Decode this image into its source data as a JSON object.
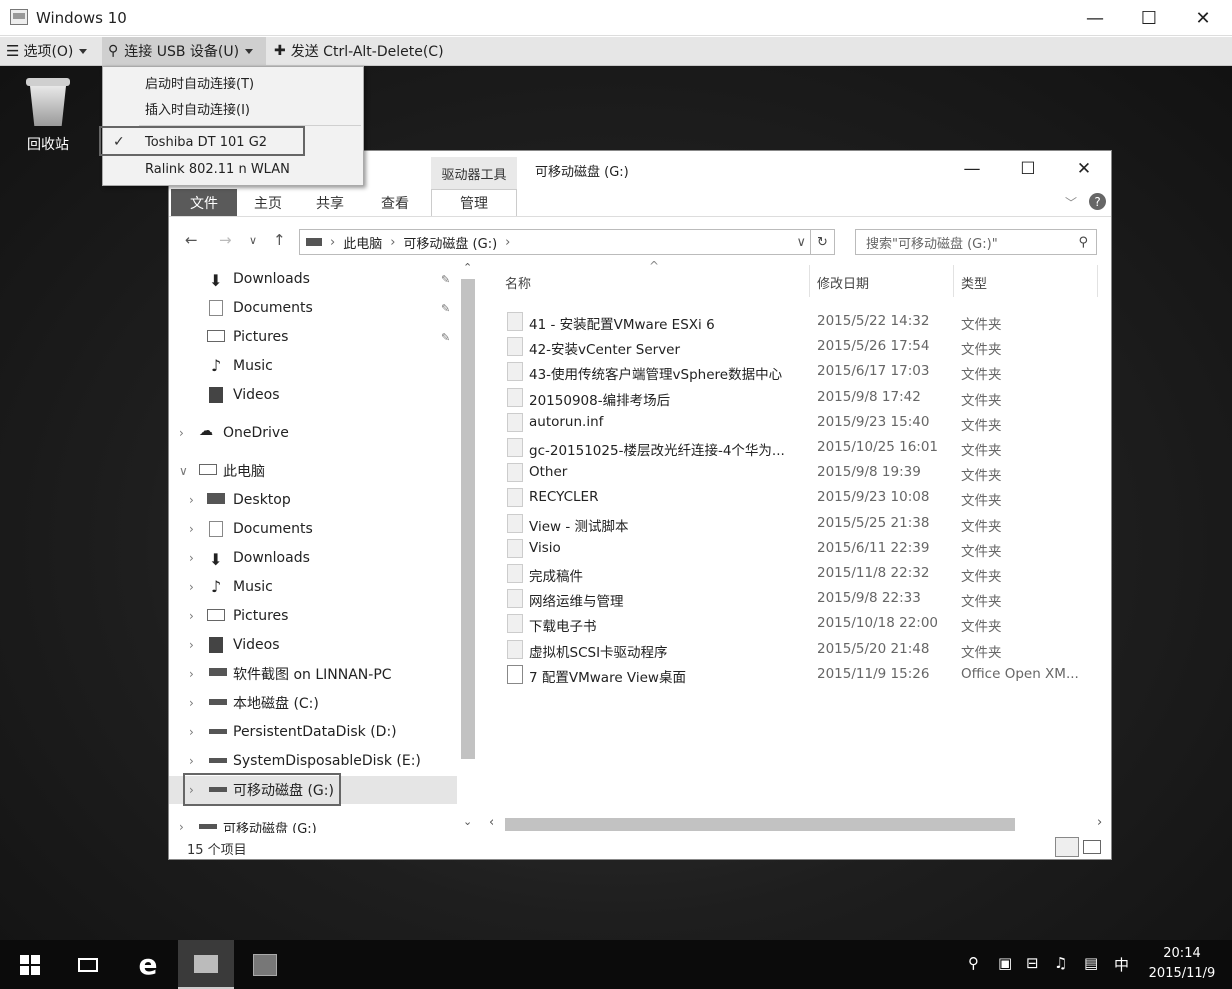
{
  "vm": {
    "title": "Windows 10",
    "menu": {
      "options": "选项(O)",
      "connect_usb": "连接 USB 设备(U)",
      "send_cad": "发送 Ctrl-Alt-Delete(C)"
    }
  },
  "dropdown": {
    "items": [
      {
        "label": "启动时自动连接(T)"
      },
      {
        "label": "插入时自动连接(I)"
      },
      {
        "label": "Toshiba DT 101 G2",
        "checked": true
      },
      {
        "label": "Ralink 802.11 n WLAN"
      }
    ]
  },
  "desktop": {
    "recycle_bin": "回收站"
  },
  "explorer": {
    "tool_label": "驱动器工具",
    "title": "可移动磁盘 (G:)",
    "ribbon": {
      "file": "文件",
      "home": "主页",
      "share": "共享",
      "view": "查看",
      "manage": "管理"
    },
    "address": {
      "crumb1": "此电脑",
      "crumb2": "可移动磁盘 (G:)"
    },
    "search_placeholder": "搜索\"可移动磁盘 (G:)\"",
    "nav": {
      "quick": [
        "Downloads",
        "Documents",
        "Pictures",
        "Music",
        "Videos"
      ],
      "onedrive": "OneDrive",
      "thispc": "此电脑",
      "pc_items": [
        "Desktop",
        "Documents",
        "Downloads",
        "Music",
        "Pictures",
        "Videos",
        "软件截图 on LINNAN-PC",
        "本地磁盘 (C:)",
        "PersistentDataDisk (D:)",
        "SystemDisposableDisk (E:)",
        "可移动磁盘 (G:)"
      ],
      "bottom": "可移动磁盘 (G:)"
    },
    "columns": {
      "name": "名称",
      "date": "修改日期",
      "type": "类型"
    },
    "files": [
      {
        "name": "41 - 安装配置VMware ESXi 6",
        "date": "2015/5/22 14:32",
        "type": "文件夹"
      },
      {
        "name": "42-安装vCenter Server",
        "date": "2015/5/26 17:54",
        "type": "文件夹"
      },
      {
        "name": "43-使用传统客户端管理vSphere数据中心",
        "date": "2015/6/17 17:03",
        "type": "文件夹"
      },
      {
        "name": "20150908-编排考场后",
        "date": "2015/9/8 17:42",
        "type": "文件夹"
      },
      {
        "name": "autorun.inf",
        "date": "2015/9/23 15:40",
        "type": "文件夹"
      },
      {
        "name": "gc-20151025-楼层改光纤连接-4个华为...",
        "date": "2015/10/25 16:01",
        "type": "文件夹"
      },
      {
        "name": "Other",
        "date": "2015/9/8 19:39",
        "type": "文件夹"
      },
      {
        "name": "RECYCLER",
        "date": "2015/9/23 10:08",
        "type": "文件夹"
      },
      {
        "name": "View - 测试脚本",
        "date": "2015/5/25 21:38",
        "type": "文件夹"
      },
      {
        "name": "Visio",
        "date": "2015/6/11 22:39",
        "type": "文件夹"
      },
      {
        "name": "完成稿件",
        "date": "2015/11/8 22:32",
        "type": "文件夹"
      },
      {
        "name": "网络运维与管理",
        "date": "2015/9/8 22:33",
        "type": "文件夹"
      },
      {
        "name": "下载电子书",
        "date": "2015/10/18 22:00",
        "type": "文件夹"
      },
      {
        "name": "虚拟机SCSI卡驱动程序",
        "date": "2015/5/20 21:48",
        "type": "文件夹"
      },
      {
        "name": "7 配置VMware View桌面",
        "date": "2015/11/9 15:26",
        "type": "Office Open XM..."
      }
    ],
    "status": "15 个项目"
  },
  "taskbar": {
    "ime": "中",
    "time": "20:14",
    "date": "2015/11/9"
  }
}
